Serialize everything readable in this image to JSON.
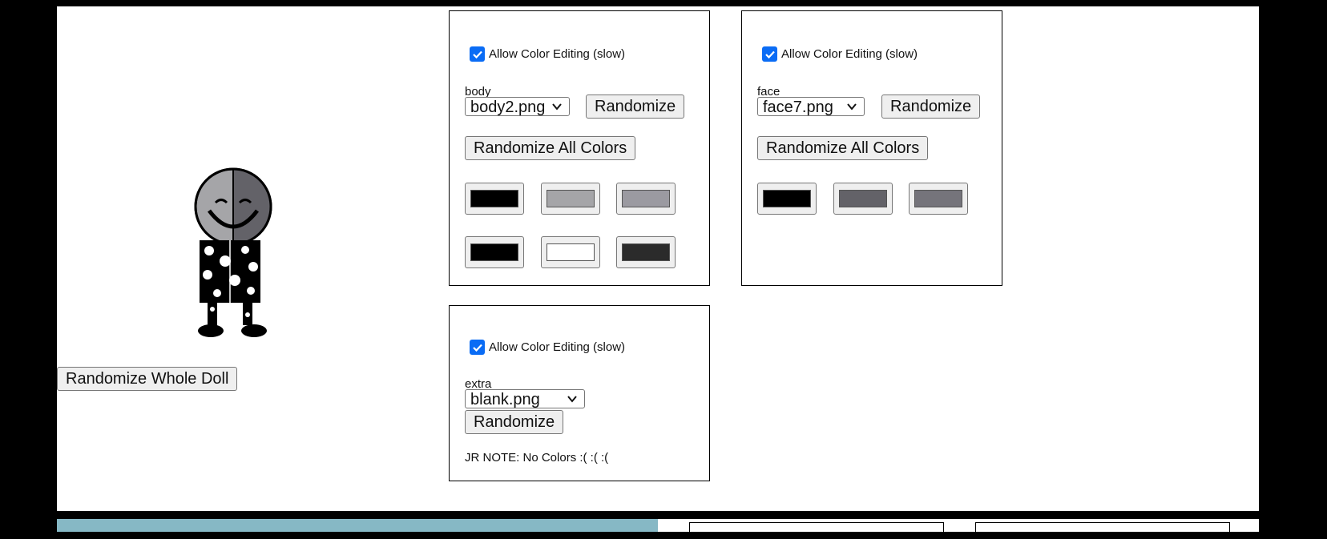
{
  "doll": {
    "whole_btn": "Randomize Whole Doll"
  },
  "panels": {
    "body": {
      "checkbox_label": "Allow Color Editing (slow)",
      "layer_label": "body",
      "selected": "body2.png",
      "randomize": "Randomize",
      "randomize_all": "Randomize All Colors",
      "swatches": [
        "#000000",
        "#a5a5a8",
        "#9b9aa1",
        "#000000",
        "#ffffff",
        "#2b2b2b"
      ]
    },
    "face": {
      "checkbox_label": "Allow Color Editing (slow)",
      "layer_label": "face",
      "selected": "face7.png",
      "randomize": "Randomize",
      "randomize_all": "Randomize All Colors",
      "swatches": [
        "#000000",
        "#636268",
        "#75747b"
      ]
    },
    "extra": {
      "checkbox_label": "Allow Color Editing (slow)",
      "layer_label": "extra",
      "selected": "blank.png",
      "randomize": "Randomize",
      "note": "JR NOTE: No Colors :( :( :("
    }
  },
  "colors": {
    "checkbox": "#0a6cf5",
    "teal_strip": "#86b8c5"
  }
}
